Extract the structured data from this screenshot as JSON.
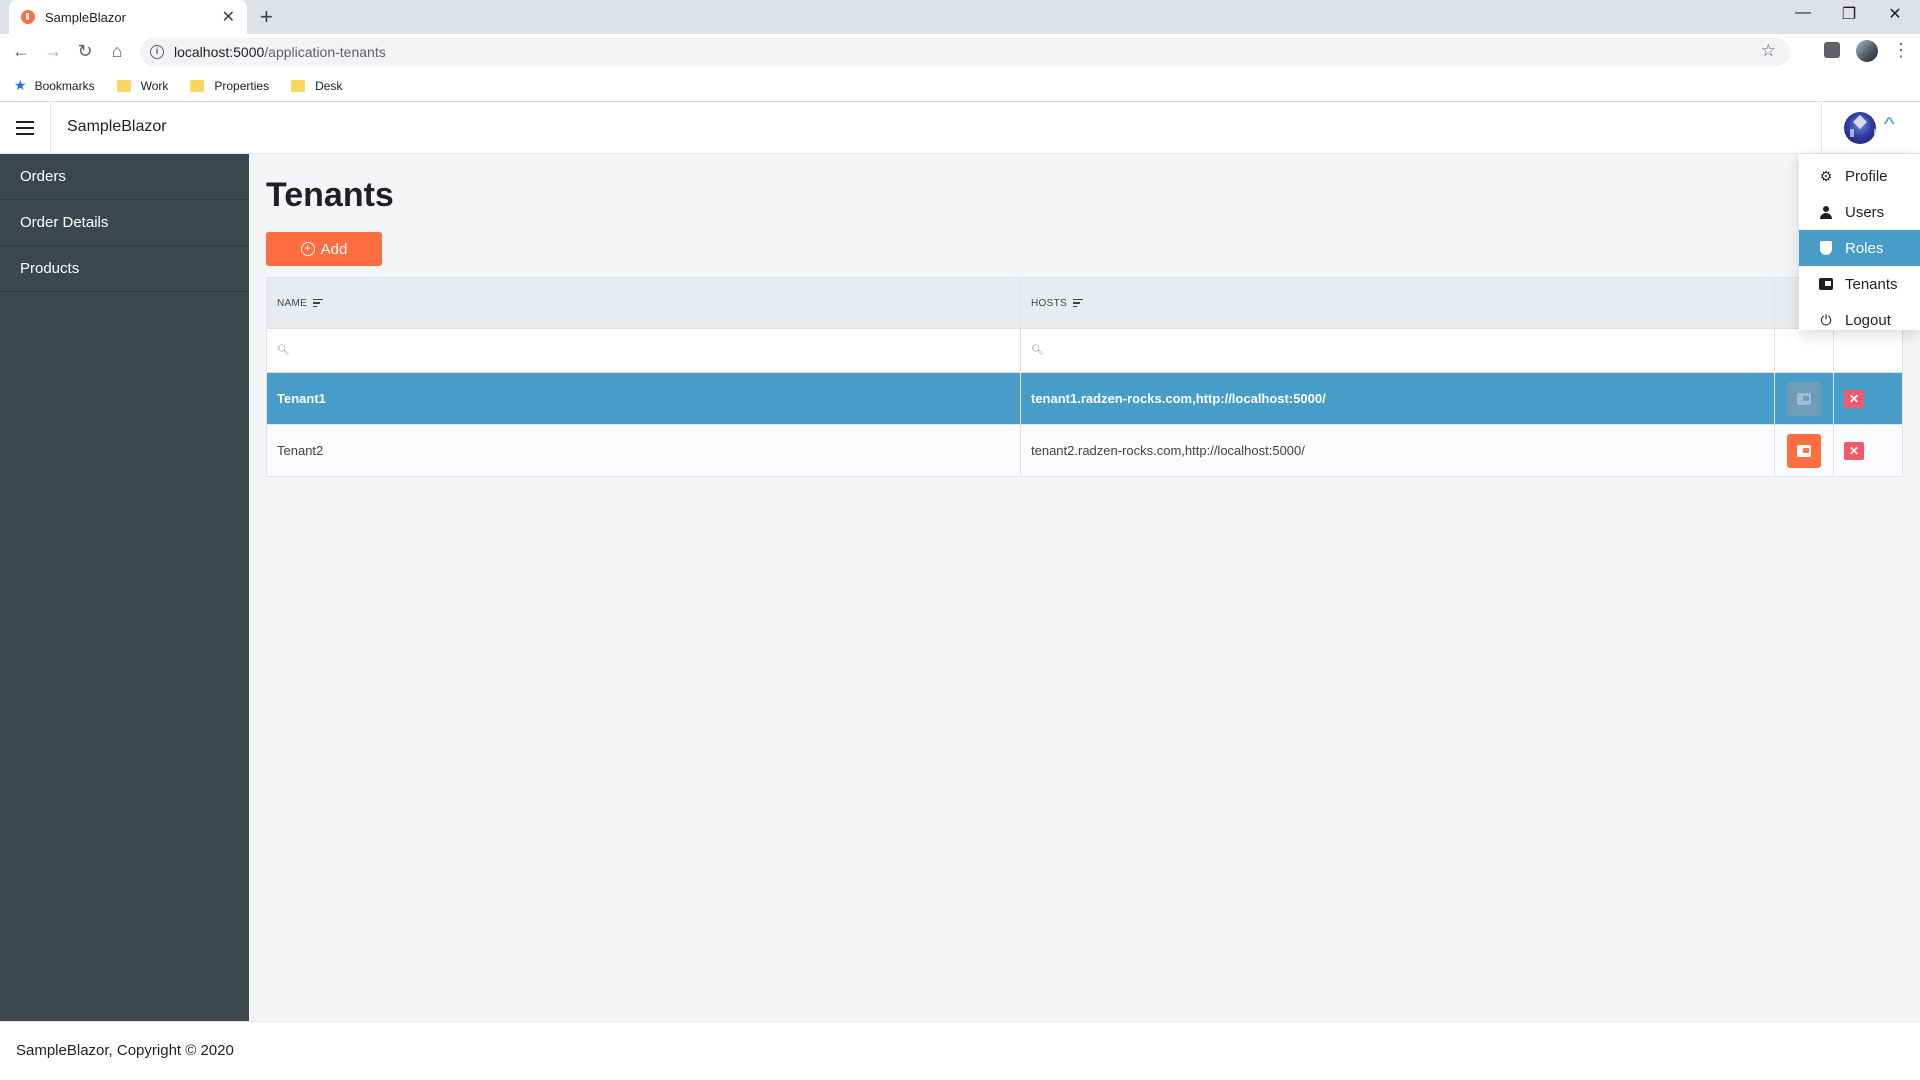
{
  "browser": {
    "tab_title": "SampleBlazor",
    "url_host": "localhost:5000",
    "url_path": "/application-tenants",
    "bookmarks": [
      {
        "label": "Bookmarks",
        "icon": "star-icon"
      },
      {
        "label": "Work",
        "icon": "folder-icon"
      },
      {
        "label": "Properties",
        "icon": "folder-icon"
      },
      {
        "label": "Desk",
        "icon": "folder-icon"
      }
    ]
  },
  "header": {
    "brand": "SampleBlazor"
  },
  "sidebar": {
    "items": [
      {
        "label": "Orders"
      },
      {
        "label": "Order Details"
      },
      {
        "label": "Products"
      }
    ]
  },
  "main": {
    "title": "Tenants",
    "add_label": "Add"
  },
  "grid": {
    "columns": [
      "NAME",
      "HOSTS"
    ],
    "rows": [
      {
        "name": "Tenant1",
        "hosts": "tenant1.radzen-rocks.com,http://localhost:5000/",
        "selected": true
      },
      {
        "name": "Tenant2",
        "hosts": "tenant2.radzen-rocks.com,http://localhost:5000/",
        "selected": false
      }
    ]
  },
  "profile_menu": {
    "items": [
      {
        "label": "Profile",
        "icon": "gear-icon"
      },
      {
        "label": "Users",
        "icon": "user-icon"
      },
      {
        "label": "Roles",
        "icon": "shield-icon",
        "active": true
      },
      {
        "label": "Tenants",
        "icon": "tenants-icon"
      },
      {
        "label": "Logout",
        "icon": "power-icon"
      }
    ]
  },
  "footer": {
    "text": "SampleBlazor, Copyright © 2020"
  },
  "colors": {
    "accent": "#ff6d41",
    "selected": "#479cc8",
    "sidebar": "#3a474d",
    "danger": "#f05a6a"
  }
}
